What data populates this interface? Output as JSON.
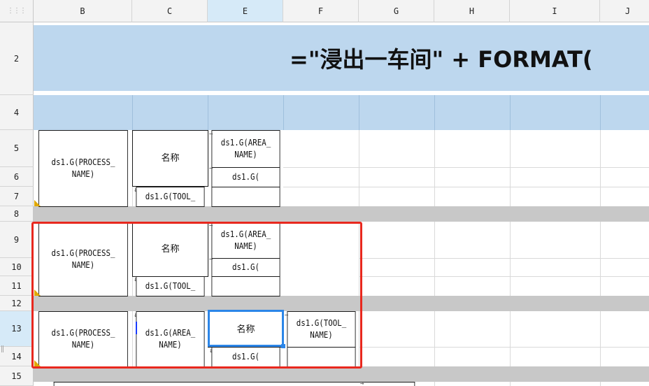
{
  "corner_glyph": "⋮⋮⋮",
  "columns": [
    "B",
    "C",
    "E",
    "F",
    "G",
    "H",
    "I",
    "J"
  ],
  "selected_column": "E",
  "rows": [
    "2",
    "4",
    "5",
    "6",
    "7",
    "8",
    "9",
    "10",
    "11",
    "12",
    "13",
    "14",
    "15"
  ],
  "selected_row": "13",
  "formula_text": "=\"浸出一车间\" + FORMAT(",
  "cells": {
    "process_name": "ds1.G(PROCESS_ NAME)",
    "name_label": "名称",
    "area_name": "ds1.G(AREA_ NAME)",
    "ds1_g": "ds1.G(",
    "tool": "ds1.G(TOOL_",
    "tool_name": "ds1.G(TOOL_ NAME)"
  },
  "colors": {
    "header_band": "#bdd7ee",
    "separator_row": "#c8c8c8",
    "highlight_box": "#e8281e",
    "selection": "#2c86e8",
    "corner_marker": "#e0a800"
  }
}
